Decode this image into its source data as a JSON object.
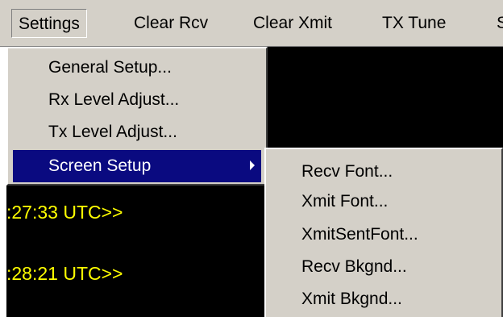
{
  "menubar": {
    "items": [
      "Settings",
      "Clear Rcv",
      "Clear Xmit",
      "TX Tune",
      "S"
    ]
  },
  "settings_menu": {
    "items": [
      {
        "label": "General Setup..."
      },
      {
        "label": "Rx Level Adjust..."
      },
      {
        "label": "Tx Level Adjust..."
      },
      {
        "label": "Screen Setup",
        "selected": true,
        "has_submenu": true
      }
    ]
  },
  "screen_setup_submenu": {
    "items": [
      "Recv Font...",
      "Xmit Font...",
      "XmitSentFont...",
      "Recv Bkgnd...",
      "Xmit Bkgnd..."
    ]
  },
  "terminal": {
    "lines": [
      ":27:33 UTC>>",
      ":28:21 UTC>>"
    ],
    "text_color": "#ffff00",
    "background": "#000000"
  },
  "colors": {
    "menu_bg": "#d4d0c8",
    "highlight": "#0a0a80"
  }
}
